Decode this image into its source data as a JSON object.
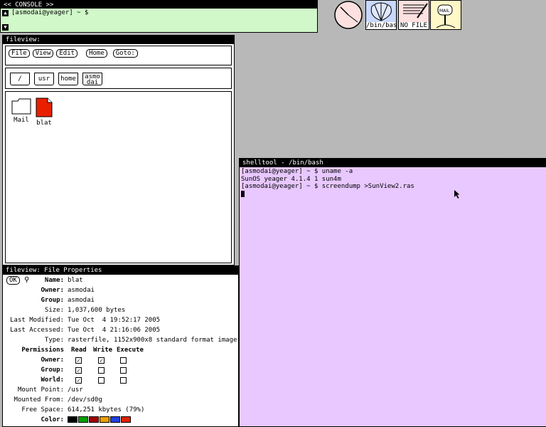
{
  "console": {
    "title": "<< CONSOLE >>",
    "prompt": "[asmodai@yeager] ~ $"
  },
  "desktop_icons": [
    {
      "name": "clock",
      "label": ""
    },
    {
      "name": "bin-bash",
      "label": "/bin/bas"
    },
    {
      "name": "no-file",
      "label": "NO FILE"
    },
    {
      "name": "mail",
      "label": ""
    }
  ],
  "fileview": {
    "title": "fileview:",
    "menu": [
      "File",
      "View",
      "Edit",
      "Home",
      "Goto:"
    ],
    "path": [
      "/",
      "usr",
      "home",
      "asmo dai"
    ],
    "files": [
      {
        "name": "Mail",
        "type": "folder"
      },
      {
        "name": "blat",
        "type": "image"
      }
    ]
  },
  "properties": {
    "title": "fileview: File Properties",
    "ok_label": "OK",
    "fields": [
      {
        "label": "Name:",
        "value": "blat"
      },
      {
        "label": "Owner:",
        "value": "asmodai"
      },
      {
        "label": "Group:",
        "value": "asmodai"
      },
      {
        "label": "Size:",
        "value": "1,037,600 bytes"
      },
      {
        "label": "Last Modified:",
        "value": "Tue Oct  4 19:52:17 2005"
      },
      {
        "label": "Last Accessed:",
        "value": "Tue Oct  4 21:16:06 2005"
      },
      {
        "label": "Type:",
        "value": "rasterfile, 1152x900x8 standard format image"
      }
    ],
    "permissions": {
      "label": "Permissions",
      "columns": [
        "Read",
        "Write",
        "Execute"
      ],
      "rows": [
        {
          "label": "Owner:",
          "read": true,
          "write": true,
          "execute": false
        },
        {
          "label": "Group:",
          "read": true,
          "write": false,
          "execute": false
        },
        {
          "label": "World:",
          "read": true,
          "write": false,
          "execute": false
        }
      ]
    },
    "mount": [
      {
        "label": "Mount Point:",
        "value": "/usr"
      },
      {
        "label": "Mounted From:",
        "value": "/dev/sd0g"
      },
      {
        "label": "Free Space:",
        "value": "614,251 kbytes (79%)"
      }
    ],
    "color_label": "Color:",
    "colors": [
      "#000000",
      "#00a000",
      "#a00000",
      "#e8a000",
      "#2040e0",
      "#e02000"
    ]
  },
  "shell": {
    "title": "shelltool - /bin/bash",
    "lines": [
      "[asmodai@yeager] ~ $ uname -a",
      "SunOS yeager 4.1.4 1 sun4m",
      "[asmodai@yeager] ~ $ screendump >SunView2.ras"
    ]
  }
}
